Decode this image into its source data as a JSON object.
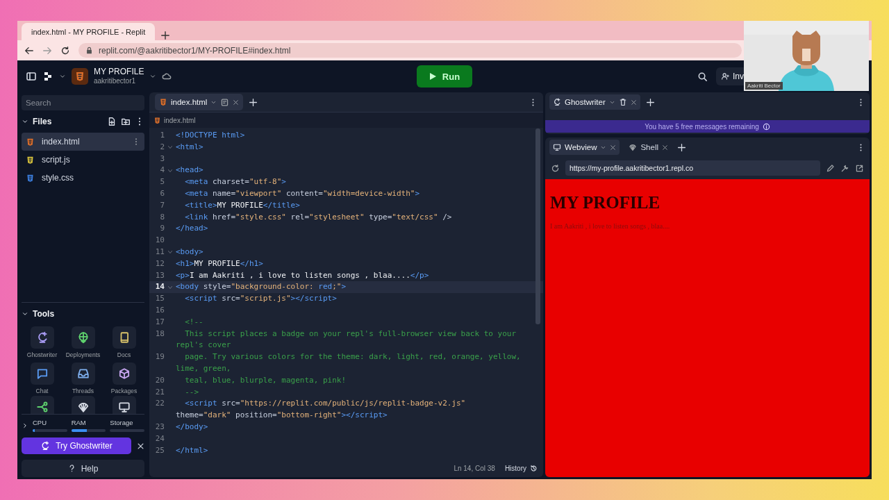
{
  "browser": {
    "tab_title": "index.html - MY PROFILE - Replit",
    "url": "replit.com/@aakritibector1/MY-PROFILE#index.html"
  },
  "header": {
    "repl_name": "MY PROFILE",
    "owner": "aakritibector1",
    "run_label": "Run",
    "invite_label": "Inv"
  },
  "webcam": {
    "kind": "picture",
    "caption": "Aakriti Bector"
  },
  "sidebar": {
    "search_placeholder": "Search",
    "files_title": "Files",
    "files": [
      {
        "name": "index.html",
        "kind": "html",
        "selected": true
      },
      {
        "name": "script.js",
        "kind": "js",
        "selected": false
      },
      {
        "name": "style.css",
        "kind": "css",
        "selected": false
      }
    ],
    "tools_title": "Tools",
    "tools": [
      {
        "label": "Ghostwriter"
      },
      {
        "label": "Deployments"
      },
      {
        "label": "Docs"
      },
      {
        "label": "Chat"
      },
      {
        "label": "Threads"
      },
      {
        "label": "Packages"
      }
    ],
    "resources": [
      {
        "label": "CPU",
        "level": 0.06
      },
      {
        "label": "RAM",
        "level": 0.45
      },
      {
        "label": "Storage",
        "level": 0
      }
    ],
    "ghostwriter_button": "Try Ghostwriter",
    "help_button": "Help"
  },
  "editor": {
    "tabs": [
      {
        "label": "index.html",
        "selected": true
      }
    ],
    "breadcrumb": "index.html",
    "lines": [
      {
        "n": "1",
        "fold": false,
        "active": false,
        "rows": [
          [
            {
              "kind": "tag",
              "text": "<!DOCTYPE html>"
            }
          ]
        ]
      },
      {
        "n": "2",
        "fold": true,
        "active": false,
        "rows": [
          [
            {
              "kind": "tag",
              "text": "<html>"
            }
          ]
        ]
      },
      {
        "n": "3",
        "fold": false,
        "active": false
      },
      {
        "n": "4",
        "fold": true,
        "active": false,
        "rows": [
          [
            {
              "kind": "tag",
              "text": "<head>"
            }
          ]
        ]
      },
      {
        "n": "5",
        "fold": false,
        "active": false,
        "rows": [
          [
            {
              "kind": "tag",
              "text": "  <meta"
            },
            {
              "kind": "attr",
              "text": " charset="
            },
            {
              "kind": "str",
              "text": "\"utf-8\""
            },
            {
              "kind": "tag",
              "text": ">"
            }
          ]
        ]
      },
      {
        "n": "6",
        "fold": false,
        "active": false,
        "rows": [
          [
            {
              "kind": "tag",
              "text": "  <meta"
            },
            {
              "kind": "attr",
              "text": " name="
            },
            {
              "kind": "str",
              "text": "\"viewport\""
            },
            {
              "kind": "attr",
              "text": " content="
            },
            {
              "kind": "str",
              "text": "\"width=device-width\""
            },
            {
              "kind": "tag",
              "text": ">"
            }
          ]
        ]
      },
      {
        "n": "7",
        "fold": false,
        "active": false,
        "rows": [
          [
            {
              "kind": "tag",
              "text": "  <title>"
            },
            {
              "kind": "text",
              "text": "MY PROFILE"
            },
            {
              "kind": "tag",
              "text": "</title>"
            }
          ]
        ]
      },
      {
        "n": "8",
        "fold": false,
        "active": false,
        "rows": [
          [
            {
              "kind": "tag",
              "text": "  <link"
            },
            {
              "kind": "attr",
              "text": " href="
            },
            {
              "kind": "str",
              "text": "\"style.css\""
            },
            {
              "kind": "attr",
              "text": " rel="
            },
            {
              "kind": "str",
              "text": "\"stylesheet\""
            },
            {
              "kind": "attr",
              "text": " type="
            },
            {
              "kind": "str",
              "text": "\"text/css\""
            },
            {
              "kind": "attr",
              "text": " />"
            }
          ]
        ]
      },
      {
        "n": "9",
        "fold": false,
        "active": false,
        "rows": [
          [
            {
              "kind": "tag",
              "text": "</head>"
            }
          ]
        ]
      },
      {
        "n": "10",
        "fold": false,
        "active": false
      },
      {
        "n": "11",
        "fold": true,
        "active": false,
        "rows": [
          [
            {
              "kind": "tag",
              "text": "<body>"
            }
          ]
        ]
      },
      {
        "n": "12",
        "fold": false,
        "active": false,
        "rows": [
          [
            {
              "kind": "tag",
              "text": "<h1>"
            },
            {
              "kind": "text",
              "text": "MY PROFILE"
            },
            {
              "kind": "tag",
              "text": "</h1>"
            }
          ]
        ]
      },
      {
        "n": "13",
        "fold": false,
        "active": false,
        "rows": [
          [
            {
              "kind": "tag",
              "text": "<p>"
            },
            {
              "kind": "text",
              "text": "I am Aakriti , i love to listen songs , blaa...."
            },
            {
              "kind": "tag",
              "text": "</p>"
            }
          ]
        ]
      },
      {
        "n": "14",
        "fold": true,
        "active": true,
        "rows": [
          [
            {
              "kind": "tag",
              "text": "<body"
            },
            {
              "kind": "attr",
              "text": " style="
            },
            {
              "kind": "str",
              "text": "\"background-color: "
            },
            {
              "kind": "tag",
              "text": "red"
            },
            {
              "kind": "str",
              "text": ";\""
            },
            {
              "kind": "tag",
              "text": ">"
            }
          ]
        ]
      },
      {
        "n": "15",
        "fold": false,
        "active": false,
        "rows": [
          [
            {
              "kind": "tag",
              "text": "  <script"
            },
            {
              "kind": "attr",
              "text": " src="
            },
            {
              "kind": "str",
              "text": "\"script.js\""
            },
            {
              "kind": "tag",
              "text": "></script>"
            }
          ]
        ]
      },
      {
        "n": "16",
        "fold": false,
        "active": false
      },
      {
        "n": "17",
        "fold": false,
        "active": false,
        "rows": [
          [
            {
              "kind": "comment",
              "text": "  <!--"
            }
          ]
        ]
      },
      {
        "n": "18",
        "fold": false,
        "active": false,
        "rows": [
          [
            {
              "kind": "comment",
              "text": "  This script places a badge on your repl's full-browser view back to your"
            }
          ],
          [
            {
              "kind": "comment",
              "text": "repl's cover"
            }
          ]
        ]
      },
      {
        "n": "19",
        "fold": false,
        "active": false,
        "rows": [
          [
            {
              "kind": "comment",
              "text": "  page. Try various colors for the theme: dark, light, red, orange, yellow,"
            }
          ],
          [
            {
              "kind": "comment",
              "text": "lime, green,"
            }
          ]
        ]
      },
      {
        "n": "20",
        "fold": false,
        "active": false,
        "rows": [
          [
            {
              "kind": "comment",
              "text": "  teal, blue, blurple, magenta, pink!"
            }
          ]
        ]
      },
      {
        "n": "21",
        "fold": false,
        "active": false,
        "rows": [
          [
            {
              "kind": "comment",
              "text": "  -->"
            }
          ]
        ]
      },
      {
        "n": "22",
        "fold": false,
        "active": false,
        "rows": [
          [
            {
              "kind": "tag",
              "text": "  <script"
            },
            {
              "kind": "attr",
              "text": " src="
            },
            {
              "kind": "str",
              "text": "\"https://replit.com/public/js/replit-badge-v2.js\""
            }
          ],
          [
            {
              "kind": "attr",
              "text": "theme="
            },
            {
              "kind": "str",
              "text": "\"dark\""
            },
            {
              "kind": "attr",
              "text": " position="
            },
            {
              "kind": "str",
              "text": "\"bottom-right\""
            },
            {
              "kind": "tag",
              "text": "></script>"
            }
          ]
        ]
      },
      {
        "n": "23",
        "fold": false,
        "active": false,
        "rows": [
          [
            {
              "kind": "tag",
              "text": "</body>"
            }
          ]
        ]
      },
      {
        "n": "24",
        "fold": false,
        "active": false
      },
      {
        "n": "25",
        "fold": false,
        "active": false,
        "rows": [
          [
            {
              "kind": "tag",
              "text": "</html>"
            }
          ]
        ]
      }
    ],
    "position": "Ln 14, Col 38",
    "history": "History"
  },
  "right": {
    "top_tabs": [
      {
        "label": "Ghostwriter",
        "selected": true
      }
    ],
    "banner": "You have 5 free messages remaining",
    "bottom_tabs": [
      {
        "label": "Webview",
        "kind": "webview",
        "selected": true
      },
      {
        "label": "Shell",
        "kind": "shell",
        "selected": false
      }
    ],
    "webview_url": "https://my-profile.aakritibector1.repl.co",
    "page": {
      "heading": "MY PROFILE",
      "paragraph": "I am Aakriti , i love to listen songs , blaa...."
    }
  }
}
